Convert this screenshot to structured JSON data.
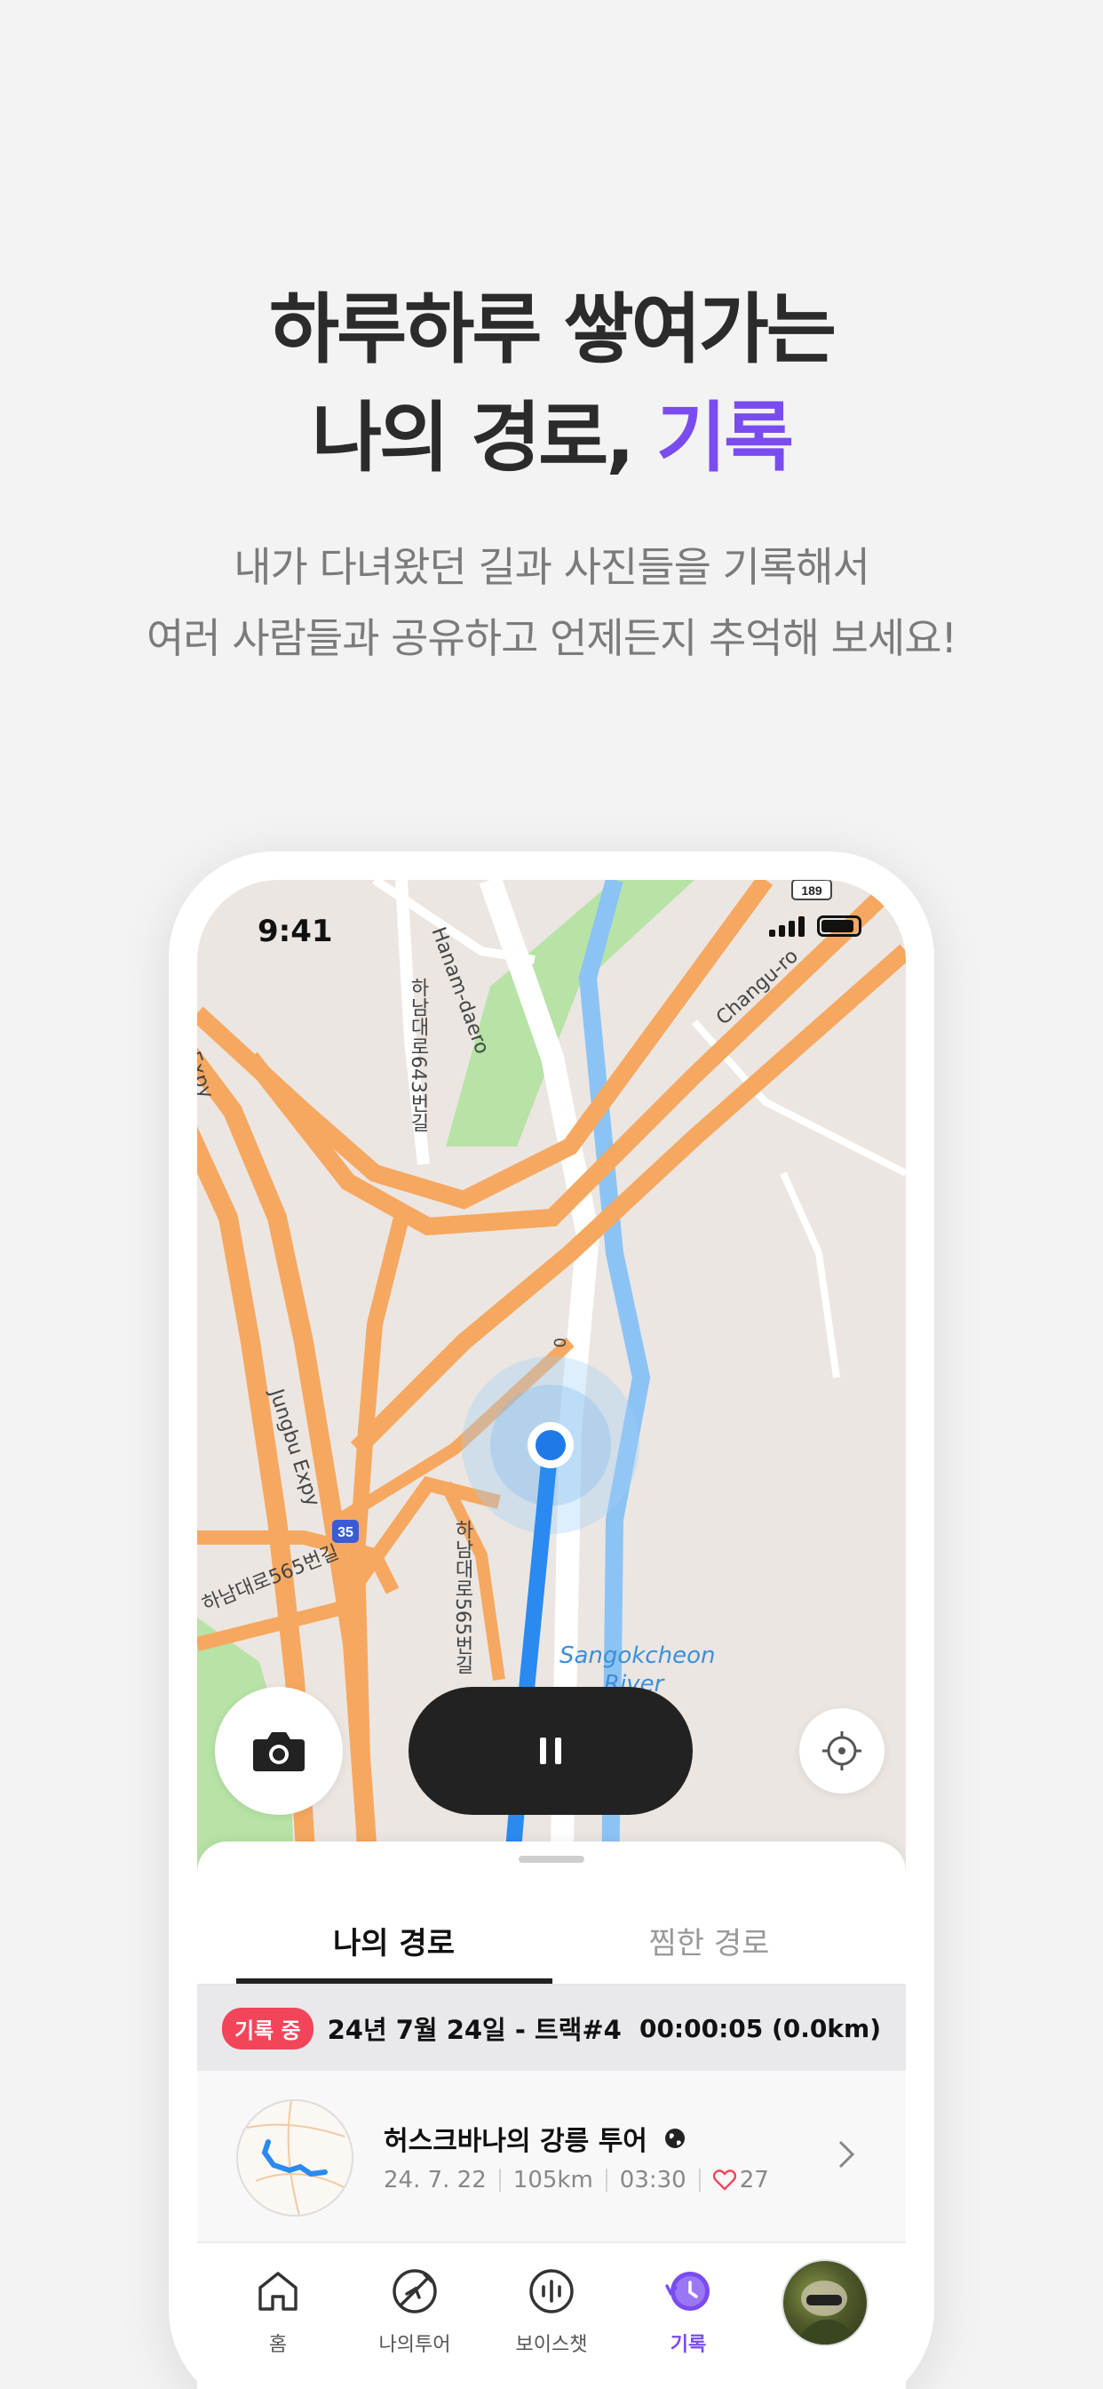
{
  "headline": {
    "line1": "하루하루 쌓여가는",
    "line2_prefix": "나의 경로, ",
    "line2_accent": "기록"
  },
  "subline": {
    "line1": "내가 다녀왔던 길과 사진들을 기록해서",
    "line2": "여러 사람들과 공유하고 언제든지 추억해 보세요!"
  },
  "colors": {
    "accent": "#7a4cf0",
    "recording_badge": "#f2455a",
    "route_line": "#2b8af0",
    "road": "#f6a860"
  },
  "status_bar": {
    "time": "9:41"
  },
  "map": {
    "labels": {
      "hanam_daero": "Hanam-daero",
      "hanam_643": "하남대로643번길",
      "changu_ro": "Changu-ro",
      "jungbu_expy": "Jungbu Expy",
      "expy_short": "Expy",
      "hanam_565": "하남대로565번길",
      "hanam_565_vertical": "하남대로565번길",
      "river": "Sangokcheon",
      "river_suffix": "River",
      "shield_35": "35",
      "shield_189": "189",
      "road_letter": "0"
    },
    "controls": {
      "camera_icon": "camera-icon",
      "pause_icon": "pause-icon",
      "locate_icon": "crosshair-icon"
    }
  },
  "tabs": [
    {
      "label": "나의 경로",
      "active": true
    },
    {
      "label": "찜한 경로",
      "active": false
    }
  ],
  "recording": {
    "badge": "기록 중",
    "title": "24년 7월 24일 - 트랙#4",
    "elapsed": "00:00:05 (0.0km)"
  },
  "routes": [
    {
      "title": "허스크바나의 강릉 투어",
      "visibility_icon": "globe-icon",
      "date": "24. 7. 22",
      "distance": "105km",
      "duration": "03:30",
      "likes": "27"
    }
  ],
  "nav": [
    {
      "label": "홈",
      "icon": "home-icon",
      "active": false
    },
    {
      "label": "나의투어",
      "icon": "tour-icon",
      "active": false
    },
    {
      "label": "보이스챗",
      "icon": "voice-chat-icon",
      "active": false
    },
    {
      "label": "기록",
      "icon": "history-icon",
      "active": true
    },
    {
      "label": "",
      "icon": "avatar",
      "active": false
    }
  ]
}
